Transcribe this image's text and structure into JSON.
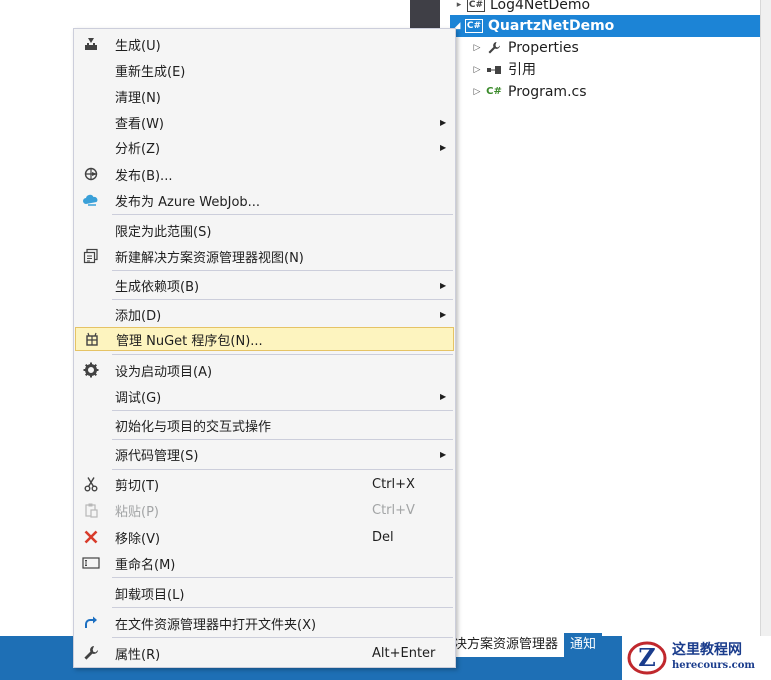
{
  "solution_explorer": {
    "items": [
      {
        "label": "Log4NetDemo",
        "expander": "▸",
        "icon": "C#"
      },
      {
        "label": "QuartzNetDemo",
        "expander": "◢",
        "icon": "C#"
      },
      {
        "label": "Properties",
        "expander": "▷",
        "icon": "wrench-icon"
      },
      {
        "label": "引用",
        "expander": "▷",
        "icon": "references-icon"
      },
      {
        "label": "Program.cs",
        "expander": "▷",
        "icon": "C#"
      }
    ],
    "tabs": [
      "决方案资源管理器",
      "通知"
    ]
  },
  "context_menu": {
    "items": [
      {
        "label": "生成(U)",
        "icon": "build-icon"
      },
      {
        "label": "重新生成(E)"
      },
      {
        "label": "清理(N)"
      },
      {
        "label": "查看(W)",
        "submenu": true
      },
      {
        "label": "分析(Z)",
        "submenu": true
      },
      {
        "label": "发布(B)...",
        "icon": "publish-icon"
      },
      {
        "label": "发布为 Azure WebJob...",
        "icon": "azure-cloud-icon"
      },
      {
        "label": "限定为此范围(S)"
      },
      {
        "label": "新建解决方案资源管理器视图(N)",
        "icon": "new-view-icon"
      },
      {
        "label": "生成依赖项(B)",
        "submenu": true
      },
      {
        "label": "添加(D)",
        "submenu": true
      },
      {
        "label": "管理 NuGet 程序包(N)...",
        "icon": "nuget-icon",
        "highlighted": true
      },
      {
        "label": "设为启动项目(A)",
        "icon": "gear-icon"
      },
      {
        "label": "调试(G)",
        "submenu": true
      },
      {
        "label": "初始化与项目的交互式操作"
      },
      {
        "label": "源代码管理(S)",
        "submenu": true
      },
      {
        "label": "剪切(T)",
        "icon": "scissors-icon",
        "shortcut": "Ctrl+X"
      },
      {
        "label": "粘贴(P)",
        "icon": "paste-icon",
        "shortcut": "Ctrl+V",
        "disabled": true
      },
      {
        "label": "移除(V)",
        "icon": "remove-icon",
        "shortcut": "Del"
      },
      {
        "label": "重命名(M)",
        "icon": "rename-icon"
      },
      {
        "label": "卸载项目(L)"
      },
      {
        "label": "在文件资源管理器中打开文件夹(X)",
        "icon": "refresh-arrow-icon"
      },
      {
        "label": "属性(R)",
        "icon": "wrench-icon",
        "shortcut": "Alt+Enter"
      }
    ]
  },
  "watermark": {
    "title": "这里教程网",
    "url": "herecours.com"
  },
  "colors": {
    "selection": "#1c84d6",
    "status_bar": "#1e6fb5",
    "highlight": "#fdf4bf",
    "menu_bg": "#f5f5f5"
  }
}
